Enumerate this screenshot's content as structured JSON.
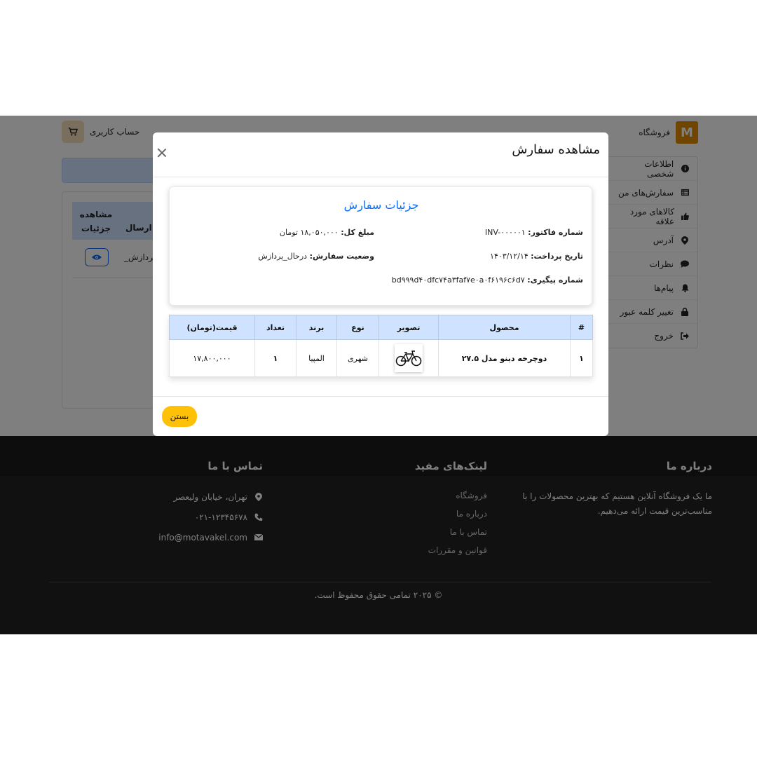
{
  "header": {
    "brand_name": "فروشگاه",
    "account_label": "حساب کاربری"
  },
  "sidebar": {
    "items": [
      {
        "label": "اطلاعات شخصی",
        "icon": "info-icon"
      },
      {
        "label": "سفارش‌های من",
        "icon": "list-icon"
      },
      {
        "label": "کالاهای مورد علاقه",
        "icon": "thumbs-up-icon"
      },
      {
        "label": "آدرس",
        "icon": "map-pin-icon"
      },
      {
        "label": "نظرات",
        "icon": "comment-icon"
      },
      {
        "label": "پیام‌ها",
        "icon": "bell-icon"
      },
      {
        "label": "تغییر کلمه عبور",
        "icon": "lock-icon"
      },
      {
        "label": "خروج",
        "icon": "logout-icon"
      }
    ]
  },
  "orders": {
    "col_view_line1": "مشاهده",
    "col_view_line2": "جزئیات",
    "col_status_partial": "ت ارسال",
    "row_status_partial": "_پردازش"
  },
  "modal": {
    "title": "مشاهده سفارش",
    "details_title": "جزئیات سفارش",
    "invoice_label": "شماره فاکتور:",
    "invoice_value": "INV-۰۰۰۰۰۱",
    "total_label": "مبلغ کل:",
    "total_value": "۱۸,۰۵۰,۰۰۰ تومان",
    "payment_date_label": "تاریخ پرداخت:",
    "payment_date_value": "۱۴۰۳/۱۲/۱۴",
    "status_label": "وضعیت سفارش:",
    "status_value": "درحال_پردازش",
    "tracking_label": "شماره پیگیری:",
    "tracking_value": "bd۹۹۹d۴۰dfc۷۴a۳faf۷e۰a۰f۶۱۹۶c۶d۷",
    "table_headers": [
      "#",
      "محصول",
      "تصویر",
      "نوع",
      "برند",
      "تعداد",
      "قیمت(تومان)"
    ],
    "items": [
      {
        "index": "۱",
        "product": "دوچرخه دینو مدل ۲۷.۵",
        "type": "شهری",
        "brand": "المپیا",
        "qty": "۱",
        "price": "۱۷,۸۰۰,۰۰۰"
      }
    ],
    "close_label": "بستن"
  },
  "footer": {
    "about_title": "درباره ما",
    "about_text": "ما یک فروشگاه آنلاین هستیم که بهترین محصولات را با مناسب‌ترین قیمت ارائه می‌دهیم.",
    "links_title": "لینک‌های مفید",
    "links": [
      "فروشگاه",
      "درباره ما",
      "تماس با ما",
      "قوانین و مقررات"
    ],
    "contact_title": "تماس با ما",
    "address": "تهران، خیابان ولیعصر",
    "phone": "۰۲۱-۱۲۳۴۵۶۷۸",
    "email": "info@motavakel.com",
    "copyright": "© ۲۰۲۵ تمامی حقوق محفوظ است."
  },
  "colors": {
    "accent": "#0d6efd",
    "table_header": "#cfe2ff",
    "close_button": "#ffc107",
    "brand_logo": "#e08a00",
    "footer_bg": "#222222"
  }
}
